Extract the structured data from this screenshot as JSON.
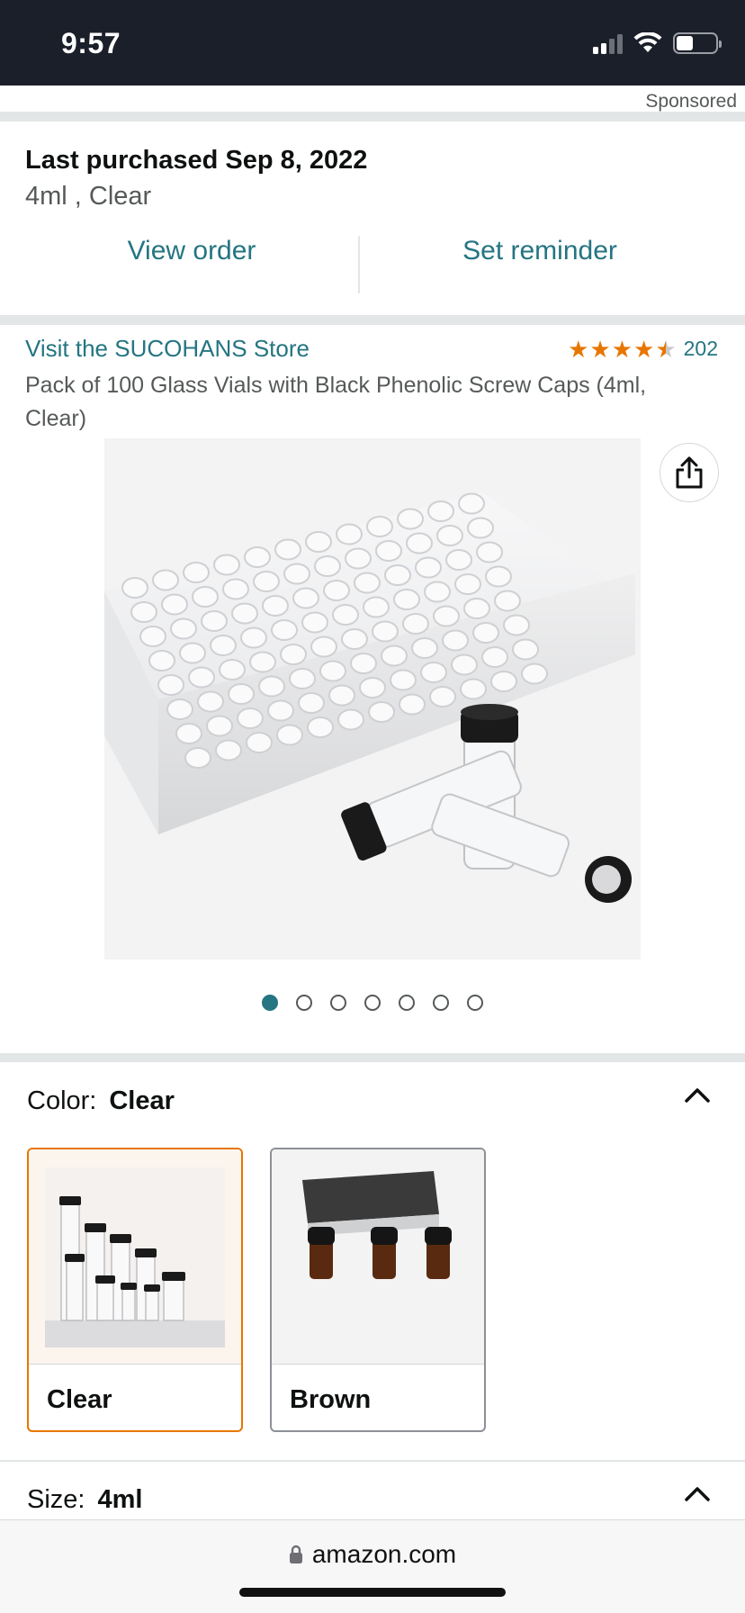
{
  "status_bar": {
    "time": "9:57"
  },
  "sponsored_label": "Sponsored",
  "last_purchased": {
    "title": "Last purchased Sep 8, 2022",
    "variant": "4ml , Clear",
    "view_order": "View order",
    "set_reminder": "Set reminder"
  },
  "product": {
    "store_link": "Visit the SUCOHANS Store",
    "rating": 4.5,
    "rating_count": "202",
    "title": "Pack of 100 Glass Vials with Black Phenolic Screw Caps (4ml, Clear)",
    "image_count": 7,
    "active_image_index": 0
  },
  "color": {
    "label": "Color:",
    "selected": "Clear",
    "options": [
      "Clear",
      "Brown"
    ]
  },
  "size": {
    "label": "Size:",
    "selected": "4ml"
  },
  "browser": {
    "url": "amazon.com"
  },
  "colors": {
    "accent_link": "#257582",
    "star": "#e77600",
    "selected_border": "#e77600",
    "status_bar_bg": "#1b1f2a"
  }
}
